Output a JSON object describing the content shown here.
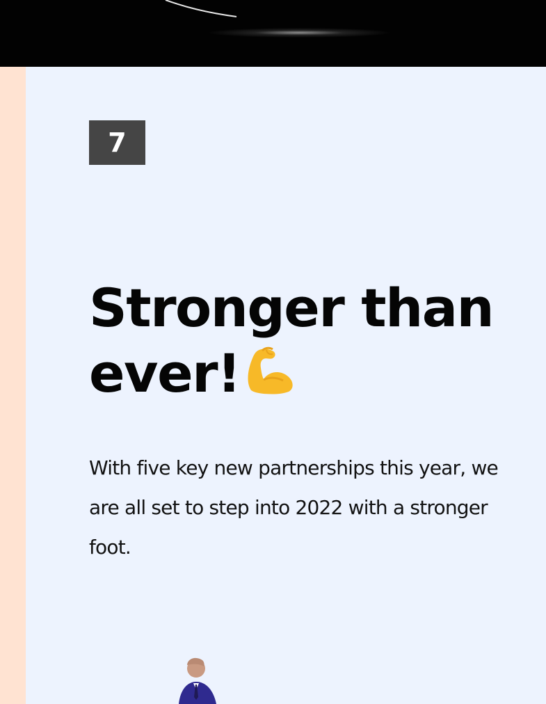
{
  "slide": {
    "number": "7",
    "headline_line1": "Stronger than",
    "headline_line2": "ever!",
    "headline_emoji": "flexed-biceps-icon",
    "body": "With five key new partnerships this year, we are all set to step into 2022 with a stronger foot."
  },
  "colors": {
    "card_background": "#edf3fe",
    "side_strip": "#ffe3d2",
    "top_bar": "#020202",
    "badge_background": "#454545",
    "headline_text": "#050505",
    "emoji": "#f7b928",
    "suit": "#2f2a8f"
  }
}
